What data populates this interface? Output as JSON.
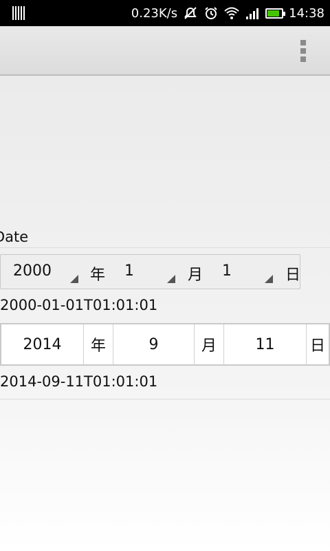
{
  "status_bar": {
    "network_speed": "0.23K/s",
    "time": "14:38",
    "icons": [
      "sim-icon",
      "notification-off-icon",
      "alarm-icon",
      "wifi-icon",
      "signal-icon",
      "battery-icon"
    ],
    "battery_color": "#43c600"
  },
  "action_bar": {
    "overflow_icon": "overflow-menu-icon"
  },
  "section": {
    "label": "Date"
  },
  "picker1": {
    "year": "2000",
    "year_unit": "年",
    "month": "1",
    "month_unit": "月",
    "day": "1",
    "day_unit": "日",
    "result": "2000-01-01T01:01:01"
  },
  "picker2": {
    "year": "2014",
    "year_unit": "年",
    "month": "9",
    "month_unit": "月",
    "day": "11",
    "day_unit": "日",
    "result": "2014-09-11T01:01:01"
  }
}
